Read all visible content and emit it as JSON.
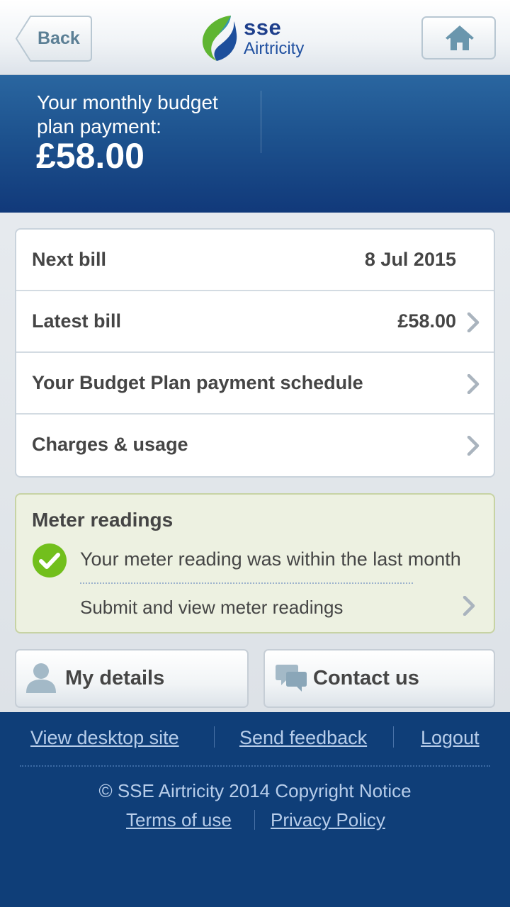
{
  "header": {
    "back_label": "Back",
    "logo_sse": "sse",
    "logo_name": "Airtricity"
  },
  "banner": {
    "label": "Your monthly budget plan payment:",
    "amount": "£58.00"
  },
  "bills": {
    "next_bill": {
      "label": "Next bill",
      "value": "8 Jul 2015"
    },
    "latest_bill": {
      "label": "Latest bill",
      "value": "£58.00"
    },
    "schedule": {
      "label": "Your Budget Plan payment schedule"
    },
    "charges": {
      "label": "Charges & usage"
    }
  },
  "meter": {
    "title": "Meter readings",
    "status": "Your meter reading was within the last month",
    "link": "Submit and view meter readings"
  },
  "actions": {
    "my_details": "My details",
    "contact_us": "Contact us"
  },
  "footer": {
    "desktop_site": "View desktop site",
    "feedback": "Send feedback",
    "logout": "Logout",
    "copyright": "© SSE Airtricity 2014 Copyright Notice",
    "terms": "Terms of use",
    "privacy": "Privacy Policy"
  },
  "colors": {
    "brand_blue": "#0f3e78",
    "header_text": "#5b7f95",
    "success_green": "#72bf1c",
    "link_color": "#b7cdea"
  }
}
